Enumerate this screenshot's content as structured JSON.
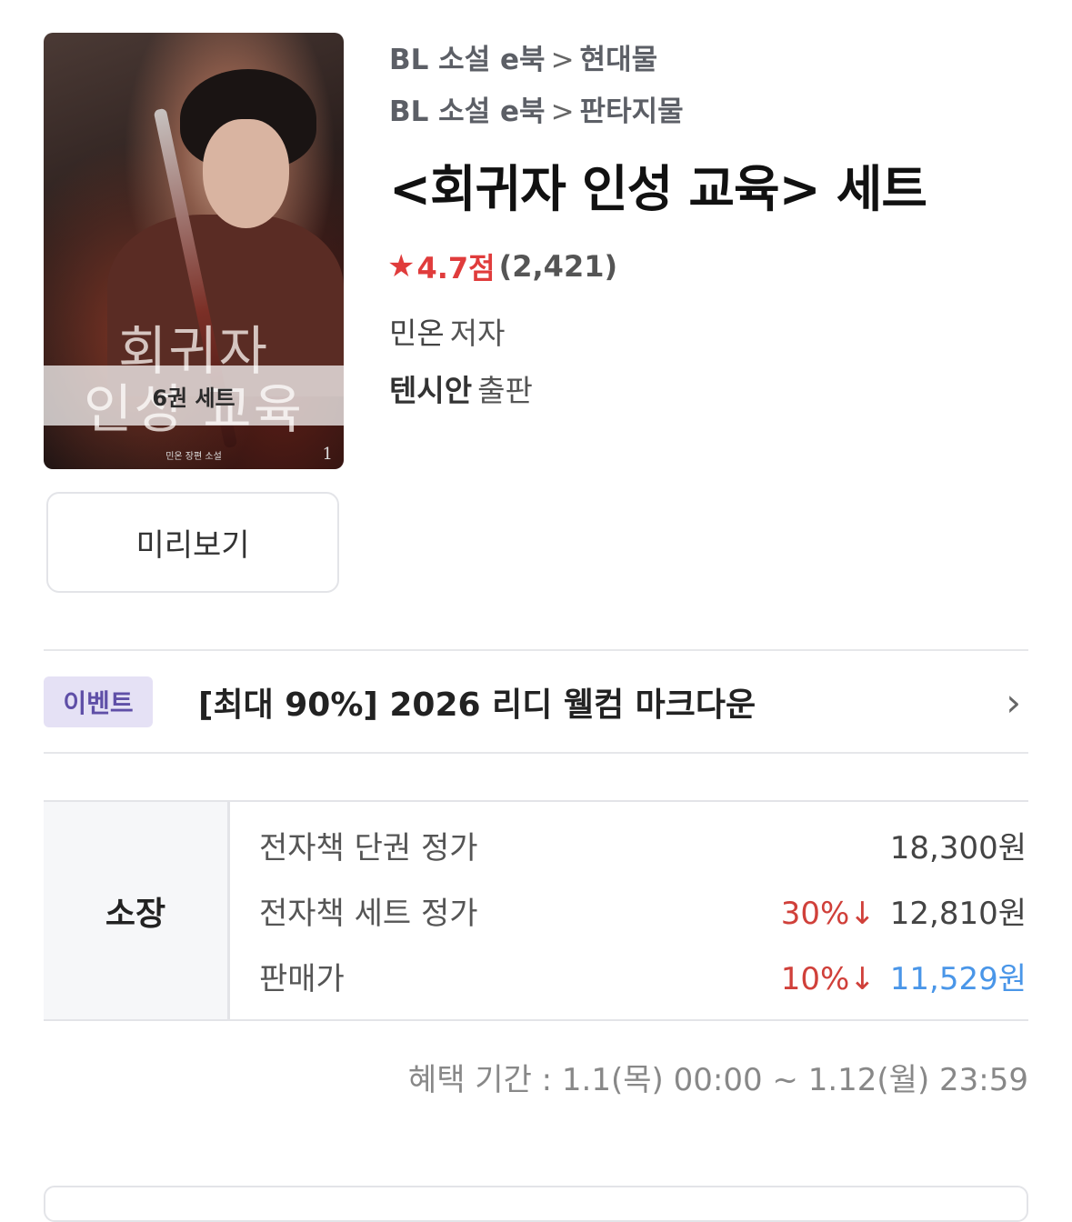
{
  "cover": {
    "set_band": "6권 세트",
    "title_art_line1": "회귀자",
    "title_art_line2": "인성 교육",
    "small_author": "민온 장편 소설",
    "volume_number": "1"
  },
  "preview_button": "미리보기",
  "breadcrumbs": [
    {
      "category": "BL 소설 e북",
      "sep": ">",
      "genre": "현대물"
    },
    {
      "category": "BL 소설 e북",
      "sep": ">",
      "genre": "판타지물"
    }
  ],
  "title": "<회귀자 인성 교육> 세트",
  "rating": {
    "star_icon": "star-icon",
    "score": "4.7점",
    "count": "(2,421)"
  },
  "author": {
    "name": "민온",
    "role": "저자"
  },
  "publisher": {
    "name": "텐시안",
    "role": "출판"
  },
  "event": {
    "badge": "이벤트",
    "text": "[최대 90%] 2026 리디 웰컴 마크다운",
    "arrow_icon": "chevron-right-icon"
  },
  "price": {
    "section_label": "소장",
    "rows": [
      {
        "label": "전자책 단권 정가",
        "discount": "",
        "value": "18,300원"
      },
      {
        "label": "전자책 세트 정가",
        "discount": "30%↓",
        "value": "12,810원"
      },
      {
        "label": "판매가",
        "discount": "10%↓",
        "value": "11,529원"
      }
    ]
  },
  "benefit_period": "혜택 기간 : 1.1(목) 00:00 ~ 1.12(월) 23:59",
  "colors": {
    "accent_red": "#e03c3c",
    "price_blue": "#4a96e8",
    "badge_purple": "#5f4fa7"
  }
}
